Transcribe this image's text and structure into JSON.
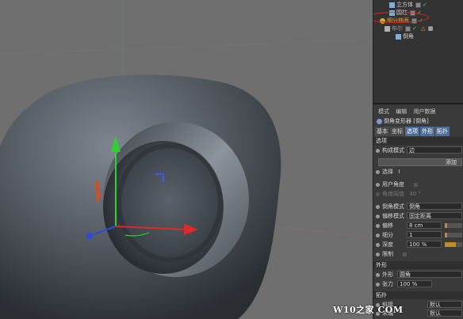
{
  "object_manager": {
    "items": [
      {
        "label": "立方体",
        "icon": "cube-icon",
        "state": "normal"
      },
      {
        "label": "圆柱",
        "icon": "cylinder-icon",
        "state": "normal"
      },
      {
        "label": "细分曲面",
        "icon": "subdivision-surface-icon",
        "state": "selected"
      },
      {
        "label": "布尔",
        "icon": "boole-icon",
        "state": "normal"
      },
      {
        "label": "倒角",
        "icon": "bevel-deformer-icon",
        "state": "normal"
      }
    ]
  },
  "attribute_manager": {
    "menu": [
      "模式",
      "编辑",
      "用户数据"
    ],
    "title": "倒角变形器 [倒角]",
    "tabs": [
      {
        "label": "基本",
        "active": false
      },
      {
        "label": "坐标",
        "active": false
      },
      {
        "label": "选项",
        "active": true
      },
      {
        "label": "外形",
        "active": true
      },
      {
        "label": "拓扑",
        "active": true
      }
    ],
    "section_options": "选项",
    "build_mode_label": "构成模式",
    "build_mode_value": "边",
    "add_button": "添加",
    "selection_label": "选择",
    "selection_value": "I",
    "use_angle_label": "用户角度",
    "angle_threshold_label": "角度阈值",
    "angle_threshold_value": "40 °",
    "bevel_mode_label": "倒角模式",
    "bevel_mode_value": "倒角",
    "offset_mode_label": "偏移模式",
    "offset_mode_value": "固定距离",
    "offset_label": "偏移",
    "offset_value": "8 cm",
    "subdivision_label": "细分",
    "subdivision_value": "1",
    "depth_label": "深度",
    "depth_value": "100 %",
    "limit_label": "限制",
    "section_shape": "外形",
    "shape_label": "外形",
    "shape_value": "圆角",
    "tension_label": "张力",
    "tension_value": "100 %",
    "section_topology": "拓扑",
    "miter_label": "斜接",
    "miter_value": "默认",
    "end_label": "末端",
    "end_value": "默认"
  },
  "watermark": "W10之家 COM",
  "colors": {
    "accent": "#e8a23a",
    "tab_active": "#4f6d9a",
    "annotation": "#d42b1e"
  }
}
